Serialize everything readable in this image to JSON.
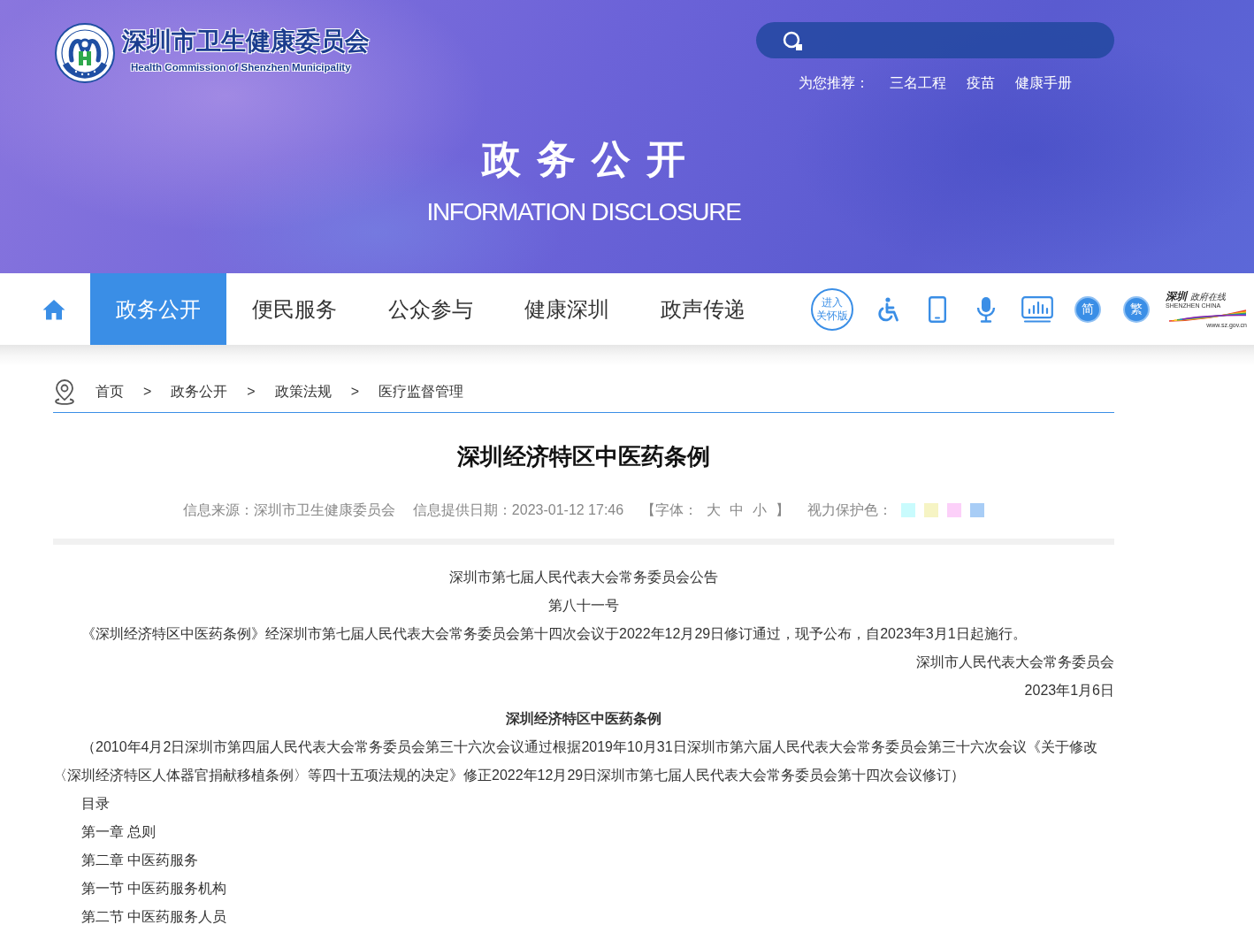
{
  "header": {
    "logo": {
      "title": "深圳市卫生健康委员会",
      "subtitle": "Health Commission of Shenzhen Municipality"
    },
    "recommend": {
      "label": "为您推荐：",
      "links": [
        "三名工程",
        "疫苗",
        "健康手册"
      ]
    },
    "banner_title": "政务公开",
    "banner_subtitle": "INFORMATION DISCLOSURE"
  },
  "nav": {
    "tabs": [
      {
        "label": "政务公开",
        "selected": true
      },
      {
        "label": "便民服务",
        "selected": false
      },
      {
        "label": "公众参与",
        "selected": false
      },
      {
        "label": "健康深圳",
        "selected": false
      },
      {
        "label": "政声传递",
        "selected": false
      }
    ],
    "care_mode": [
      "进入",
      "关怀版"
    ],
    "script_toggles": [
      "简",
      "繁"
    ],
    "gov_logo": {
      "title": "深圳",
      "subtitle": "政府在线",
      "tagline": "SHENZHEN CHINA",
      "url": "www.sz.gov.cn"
    }
  },
  "breadcrumb": [
    {
      "label": "首页"
    },
    {
      "separator": ">",
      "label": "政务公开"
    },
    {
      "separator": ">",
      "label": "政策法规"
    },
    {
      "separator": ">",
      "label": "医疗监督管理"
    }
  ],
  "article": {
    "title": "深圳经济特区中医药条例",
    "meta": {
      "source": "信息来源：深圳市卫生健康委员会",
      "date": "信息提供日期：2023-01-12 17:46",
      "font_label": "【字体：",
      "font_sizes": [
        "大",
        "中",
        "小"
      ],
      "font_close": "】",
      "eye_care_label": "视力保护色：",
      "eye_care_colors": [
        {
          "color": "#c9fbfd"
        },
        {
          "color": "#f6f4c4"
        },
        {
          "color": "#fcd0f9"
        },
        {
          "color": "#a8cdf6"
        }
      ]
    },
    "paragraphs": [
      {
        "kind": "centered",
        "text": "深圳市第七届人民代表大会常务委员会公告"
      },
      {
        "kind": "centered",
        "text": "第八十一号"
      },
      {
        "kind": "paragraph",
        "text": "《深圳经济特区中医药条例》经深圳市第七届人民代表大会常务委员会第十四次会议于2022年12月29日修订通过，现予公布，自2023年3月1日起施行。"
      },
      {
        "kind": "right",
        "text": "深圳市人民代表大会常务委员会"
      },
      {
        "kind": "right",
        "text": "2023年1月6日"
      },
      {
        "kind": "heading",
        "text": "深圳经济特区中医药条例"
      },
      {
        "kind": "paragraph",
        "text": "（2010年4月2日深圳市第四届人民代表大会常务委员会第三十六次会议通过根据2019年10月31日深圳市第六届人民代表大会常务委员会第三十六次会议《关于修改〈深圳经济特区人体器官捐献移植条例〉等四十五项法规的决定》修正2022年12月29日深圳市第七届人民代表大会常务委员会第十四次会议修订）"
      },
      {
        "kind": "paragraph",
        "text": "目录"
      },
      {
        "kind": "paragraph",
        "text": "第一章 总则"
      },
      {
        "kind": "paragraph",
        "text": "第二章 中医药服务"
      },
      {
        "kind": "paragraph",
        "text": "第一节 中医药服务机构"
      },
      {
        "kind": "paragraph",
        "text": "第二节 中医药服务人员"
      }
    ]
  }
}
